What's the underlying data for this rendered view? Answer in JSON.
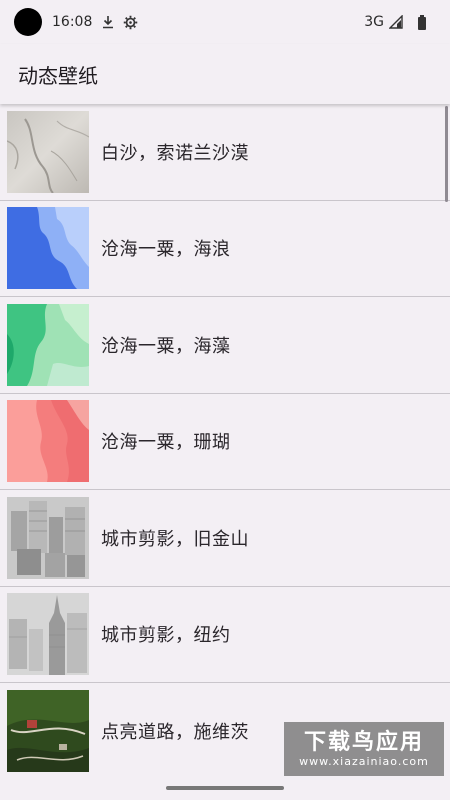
{
  "status_bar": {
    "time": "16:08",
    "network": "3G",
    "icons": [
      "download-icon",
      "settings-icon",
      "signal-icon",
      "battery-icon"
    ]
  },
  "app_bar": {
    "title": "动态壁纸"
  },
  "wallpapers": [
    {
      "label": "白沙，索诺兰沙漠"
    },
    {
      "label": "沧海一粟，海浪"
    },
    {
      "label": "沧海一粟，海藻"
    },
    {
      "label": "沧海一粟，珊瑚"
    },
    {
      "label": "城市剪影，旧金山"
    },
    {
      "label": "城市剪影，纽约"
    },
    {
      "label": "点亮道路，施维茨"
    }
  ],
  "watermark": {
    "title": "下载鸟应用",
    "url": "www.xiazainiao.com"
  },
  "colors": {
    "background": "#f3eff4",
    "divider": "#c9c5cb"
  }
}
